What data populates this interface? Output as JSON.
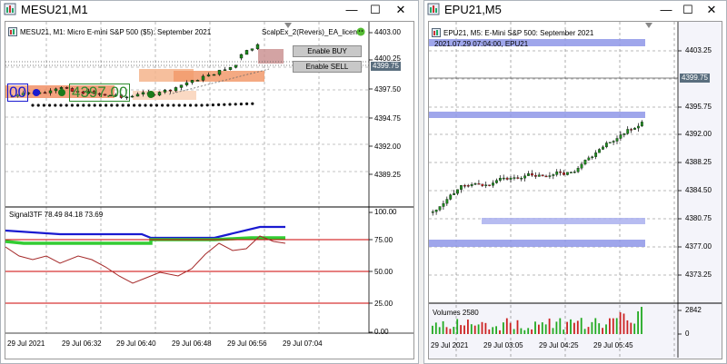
{
  "left_window": {
    "title": "MESU21,M1",
    "info": "MESU21, M1:  Micro E-mini S&P 500 ($5): September 2021",
    "ea_label": "ScalpEx_2(Revers)_EA_license",
    "btn_buy": "Enable BUY",
    "btn_sell": "Enable SELL",
    "price_tag": "4399.75",
    "big_left": "00",
    "big_price": "4397.00",
    "price_axis": [
      "4403.00",
      "4400.25",
      "4397.50",
      "4394.75",
      "4392.00",
      "4389.25"
    ],
    "indicator_label": "Signal3TF 78.49 84.18 73.69",
    "indicator_axis": [
      "100.00",
      "75.00",
      "50.00",
      "25.00",
      "0.00"
    ],
    "time_axis": [
      "29 Jul 2021",
      "29 Jul 06:32",
      "29 Jul 06:40",
      "29 Jul 06:48",
      "29 Jul 06:56",
      "29 Jul 07:04"
    ],
    "colors": {
      "blue": "#1a1ad0",
      "green": "#33cc33",
      "red": "#cc0000",
      "brown": "#a52a2a"
    }
  },
  "right_window": {
    "title": "EPU21,M5",
    "info": "EPU21, M5:  E-Mini S&P 500: September 2021",
    "info2": "2021.07.29 07:04:00, EPU21",
    "price_tag": "4399.75",
    "price_axis": [
      "4403.25",
      "4399.75",
      "4395.75",
      "4392.00",
      "4388.25",
      "4384.50",
      "4380.75",
      "4377.00",
      "4373.25"
    ],
    "volumes_label": "Volumes 2580",
    "volume_axis": [
      "2842",
      "0"
    ],
    "time_axis": [
      "29 Jul 2021",
      "29 Jul 03:05",
      "29 Jul 04:25",
      "29 Jul 05:45"
    ]
  }
}
